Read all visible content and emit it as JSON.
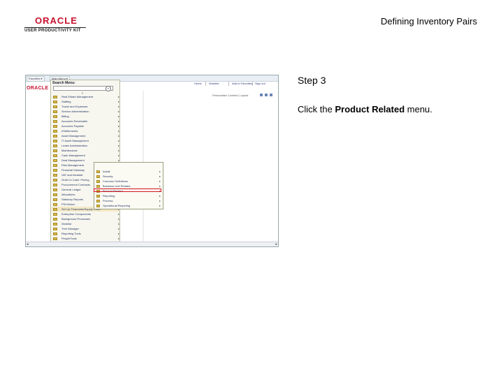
{
  "logo": {
    "brand": "ORACLE",
    "product": "USER PRODUCTIVITY KIT"
  },
  "doc_title": "Defining Inventory Pairs",
  "step": {
    "label": "Step 3"
  },
  "instruction": {
    "prefix": "Click the ",
    "target": "Product Related",
    "suffix": " menu."
  },
  "screenshot": {
    "tabs": [
      "Favorites ▾",
      "Main Menu ▾"
    ],
    "top_nav": [
      "Home",
      "Worklist",
      "Add to Favorites",
      "Sign out"
    ],
    "personalize": "Personalize Content | Layout",
    "favorites_panel": {
      "heading": "Search Menu:",
      "search_button": "»",
      "controls": "≡"
    },
    "menu_items": [
      "Real Estate Management",
      "Staffing",
      "Travel and Expenses",
      "Service Administration",
      "Billing",
      "Accounts Receivable",
      "Accounts Payable",
      "eSettlements",
      "Asset Management",
      "IT Asset Management",
      "Lease Administration",
      "Maintenance",
      "Cash Management",
      "Deal Management",
      "Risk Management",
      "Financial Gateway",
      "VAT and Intrastat",
      "Order to Cash: Pricing",
      "Procurement Contracts",
      "General Ledger",
      "Allocations",
      "Statutory Reports",
      "PS/nVision",
      "Set Up Financials/Supply Chain",
      "Enterprise Components",
      "Background Processes",
      "Worklist",
      "Tree Manager",
      "Reporting Tools",
      "PeopleTools"
    ],
    "highlighted_menu_index": 23,
    "flyout_items": [
      "Install",
      "Security",
      "Common Definitions",
      "Business Unit Related",
      "Product Related",
      "Reporting",
      "Process",
      "Operational Reporting"
    ],
    "target_flyout_index": 4
  }
}
